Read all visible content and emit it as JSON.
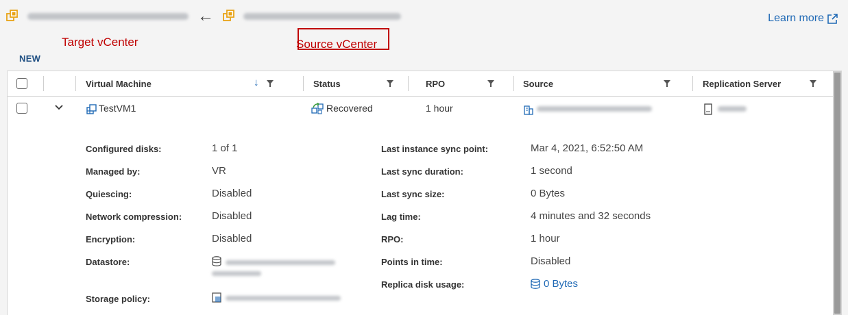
{
  "header": {
    "arrow": "←",
    "target_label": "Target vCenter",
    "source_label": "Source vCenter",
    "new_badge": "NEW",
    "learn_more": "Learn more"
  },
  "table": {
    "columns": [
      {
        "key": "virtual_machine",
        "label": "Virtual Machine",
        "sorted": "descending",
        "filterable": true
      },
      {
        "key": "status",
        "label": "Status",
        "filterable": true
      },
      {
        "key": "rpo",
        "label": "RPO",
        "filterable": true
      },
      {
        "key": "source",
        "label": "Source",
        "filterable": true
      },
      {
        "key": "replication_server",
        "label": "Replication Server",
        "filterable": true
      }
    ],
    "rows": [
      {
        "virtual_machine": "TestVM1",
        "status": "Recovered",
        "rpo": "1 hour",
        "expanded": true
      }
    ]
  },
  "details": {
    "left": [
      {
        "label": "Configured disks:",
        "value": "1 of 1"
      },
      {
        "label": "Managed by:",
        "value": "VR"
      },
      {
        "label": "Quiescing:",
        "value": "Disabled"
      },
      {
        "label": "Network compression:",
        "value": "Disabled"
      },
      {
        "label": "Encryption:",
        "value": "Disabled"
      },
      {
        "label": "Datastore:",
        "value": ""
      },
      {
        "label": "Storage policy:",
        "value": ""
      }
    ],
    "right": [
      {
        "label": "Last instance sync point:",
        "value": "Mar 4, 2021, 6:52:50 AM"
      },
      {
        "label": "Last sync duration:",
        "value": "1 second"
      },
      {
        "label": "Last sync size:",
        "value": "0 Bytes"
      },
      {
        "label": "Lag time:",
        "value": "4 minutes and 32 seconds"
      },
      {
        "label": "RPO:",
        "value": "1 hour"
      },
      {
        "label": "Points in time:",
        "value": "Disabled"
      },
      {
        "label": "Replica disk usage:",
        "value": "0 Bytes"
      }
    ]
  },
  "colors": {
    "annotation": "#c00000",
    "link": "#1f69b5",
    "badge": "#1f4f82"
  }
}
